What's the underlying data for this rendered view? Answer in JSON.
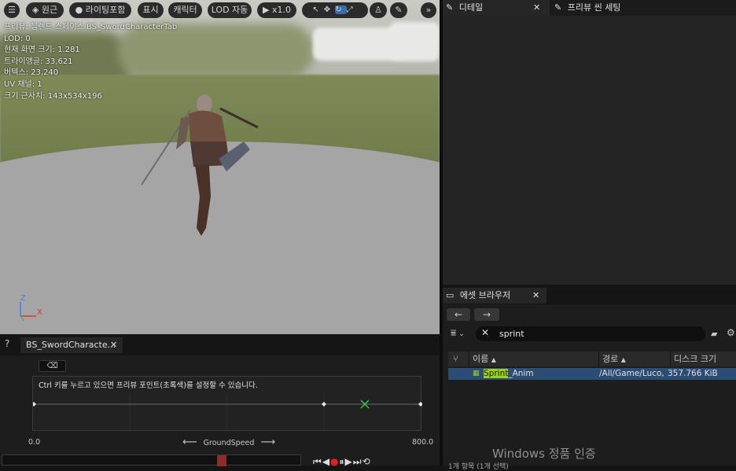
{
  "viewport": {
    "toolbar": {
      "menu_label": "☰",
      "perspective_label": "원근",
      "lighting_label": "라이팅포함",
      "show_label": "표시",
      "character_label": "캐릭터",
      "lod_label": "LOD 자동",
      "speed_label": "x1.0"
    },
    "stats": [
      "프리뷰: 블렌드 스페이스 BS_SwordCharacterTab",
      "LOD: 0",
      "현재 화면 크기: 1.281",
      "트라이앵글: 33,621",
      "버텍스: 23,240",
      "UV 채널: 1",
      "크기 근사치: 143x534x196"
    ],
    "axis_z": "Z",
    "axis_x": "X"
  },
  "details_panel": {
    "tab1": "디테일",
    "tab2": "프리뷰 씬 세팅"
  },
  "blendspace_editor": {
    "tab_label": "BS_SwordCharacte...",
    "hint": "Ctrl 키를 누르고 있으면 프리뷰 포인트(초록색)를 설정할 수 있습니다.",
    "axis_min": "0.0",
    "axis_max": "800.0",
    "axis_name": "GroundSpeed"
  },
  "asset_browser": {
    "tab_label": "에셋 브라우저",
    "search_value": "sprint",
    "columns": {
      "name": "이름",
      "path": "경로",
      "size": "디스크 크기"
    },
    "row": {
      "name_highlight": "Sprint",
      "name_rest": "_Anim",
      "path": "/All/Game/Luco,",
      "size": "357.766 KiB"
    },
    "status": "1개 항목 (1개 선택)"
  },
  "watermark": "Windows 정품 인증",
  "colors": {
    "accent": "#2b4c73",
    "highlight": "#9bd11f",
    "preview_point": "#3ac23a"
  }
}
